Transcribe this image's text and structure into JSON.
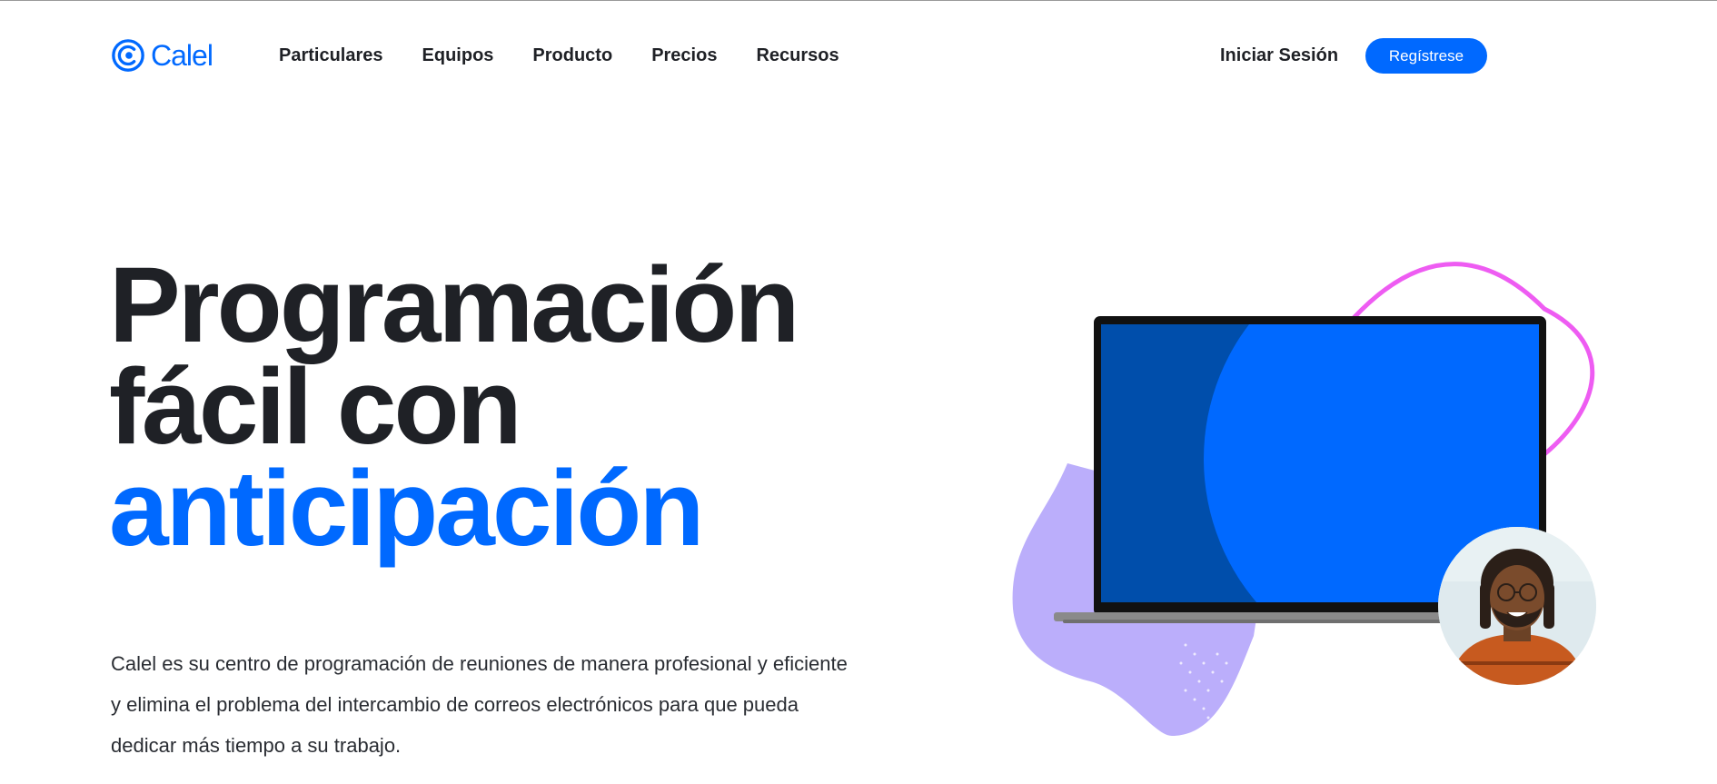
{
  "brand": {
    "name": "Calel",
    "accent_color": "#0069ff",
    "icon": "calel-logo-icon"
  },
  "nav": {
    "links": [
      "Particulares",
      "Equipos",
      "Producto",
      "Precios",
      "Recursos"
    ],
    "signin_label": "Iniciar Sesión",
    "signup_label": "Regístrese"
  },
  "hero": {
    "title_line1": "Programación",
    "title_line2": "fácil con",
    "title_line3": "anticipación",
    "description": "Calel es su centro de programación de reuniones de manera profesional y eficiente y elimina el problema del intercambio de correos electrónicos para que pueda dedicar más tiempo a su trabajo."
  },
  "illustration": {
    "icons": [
      "laptop-icon",
      "user-avatar"
    ],
    "colors": {
      "screen_dark": "#004eab",
      "screen_blue": "#0069ff",
      "lavender": "#bbaefb",
      "pink_outline": "#ee5cf2"
    }
  }
}
